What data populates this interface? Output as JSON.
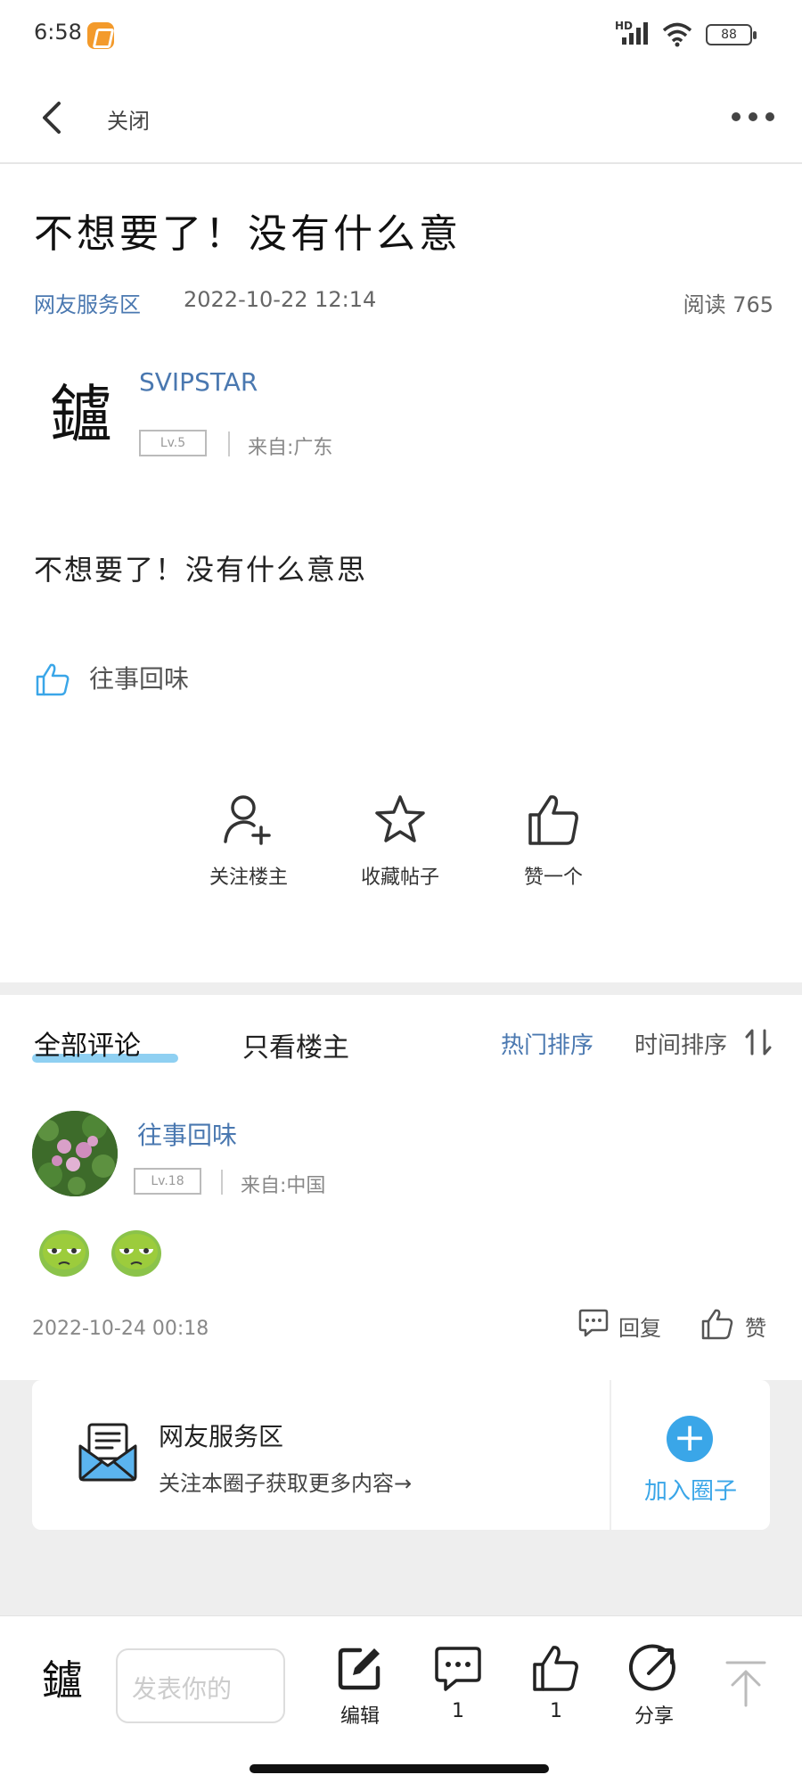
{
  "status_bar": {
    "time": "6:58",
    "network": "HD",
    "battery": "88"
  },
  "nav": {
    "close_label": "关闭"
  },
  "post": {
    "title": "不想要了！没有什么意",
    "forum": "网友服务区",
    "date": "2022-10-22 12:14",
    "reads": "阅读 765",
    "author": {
      "name": "SVIPSTAR",
      "level": "Lv.5",
      "from": "来自:广东",
      "avatar_glyph": "鑪"
    },
    "body": "不想要了！没有什么意思",
    "liked_by": "往事回味"
  },
  "actions": [
    {
      "label": "关注楼主",
      "icon": "follow-user-icon"
    },
    {
      "label": "收藏帖子",
      "icon": "star-icon"
    },
    {
      "label": "赞一个",
      "icon": "thumbs-up-icon"
    }
  ],
  "comments_header": {
    "tab_all": "全部评论",
    "tab_op": "只看楼主",
    "sort_hot": "热门排序",
    "sort_time": "时间排序"
  },
  "comments": [
    {
      "name": "往事回味",
      "level": "Lv.18",
      "from": "来自:中国",
      "time": "2022-10-24 00:18",
      "reply_label": "回复",
      "like_label": "赞",
      "stickers": [
        "green-face-sticker",
        "green-face-sticker"
      ]
    }
  ],
  "circle": {
    "name": "网友服务区",
    "subtitle": "关注本圈子获取更多内容→",
    "join_label": "加入圈子"
  },
  "bottom_bar": {
    "placeholder": "发表你的",
    "edit_label": "编辑",
    "comment_count": "1",
    "like_count": "1",
    "share_label": "分享"
  },
  "colors": {
    "link_blue": "#4a78b0",
    "accent_blue": "#3aa6e8",
    "underline": "#8fd0f2",
    "band_gray": "#eeeeee"
  }
}
